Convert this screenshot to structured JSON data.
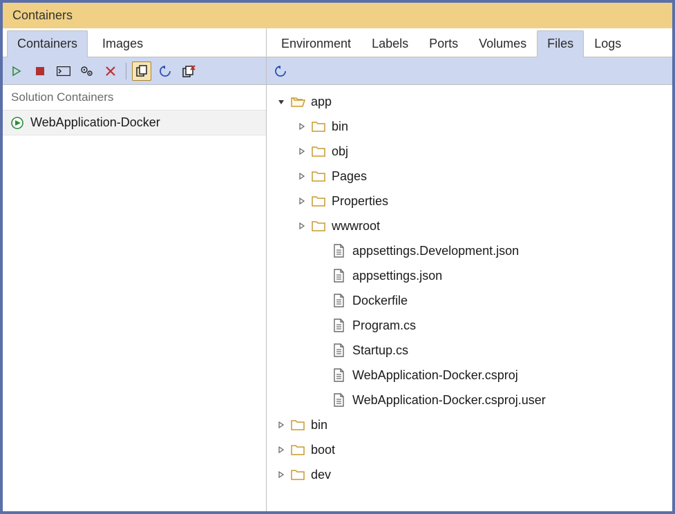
{
  "title": "Containers",
  "left_tabs": [
    {
      "label": "Containers",
      "active": true
    },
    {
      "label": "Images",
      "active": false
    }
  ],
  "right_tabs": [
    {
      "label": "Environment",
      "active": false
    },
    {
      "label": "Labels",
      "active": false
    },
    {
      "label": "Ports",
      "active": false
    },
    {
      "label": "Volumes",
      "active": false
    },
    {
      "label": "Files",
      "active": true
    },
    {
      "label": "Logs",
      "active": false
    }
  ],
  "list_header": "Solution Containers",
  "containers": [
    {
      "name": "WebApplication-Docker",
      "running": true
    }
  ],
  "file_tree": [
    {
      "level": 0,
      "kind": "folder-open",
      "expanded": true,
      "label": "app"
    },
    {
      "level": 1,
      "kind": "folder",
      "expanded": false,
      "label": "bin"
    },
    {
      "level": 1,
      "kind": "folder",
      "expanded": false,
      "label": "obj"
    },
    {
      "level": 1,
      "kind": "folder",
      "expanded": false,
      "label": "Pages"
    },
    {
      "level": 1,
      "kind": "folder",
      "expanded": false,
      "label": "Properties"
    },
    {
      "level": 1,
      "kind": "folder",
      "expanded": false,
      "label": "wwwroot"
    },
    {
      "level": 2,
      "kind": "file",
      "label": "appsettings.Development.json"
    },
    {
      "level": 2,
      "kind": "file",
      "label": "appsettings.json"
    },
    {
      "level": 2,
      "kind": "file",
      "label": "Dockerfile"
    },
    {
      "level": 2,
      "kind": "file",
      "label": "Program.cs"
    },
    {
      "level": 2,
      "kind": "file",
      "label": "Startup.cs"
    },
    {
      "level": 2,
      "kind": "file",
      "label": "WebApplication-Docker.csproj"
    },
    {
      "level": 2,
      "kind": "file",
      "label": "WebApplication-Docker.csproj.user"
    },
    {
      "level": 0,
      "kind": "folder",
      "expanded": false,
      "label": "bin"
    },
    {
      "level": 0,
      "kind": "folder",
      "expanded": false,
      "label": "boot"
    },
    {
      "level": 0,
      "kind": "folder",
      "expanded": false,
      "label": "dev"
    }
  ]
}
